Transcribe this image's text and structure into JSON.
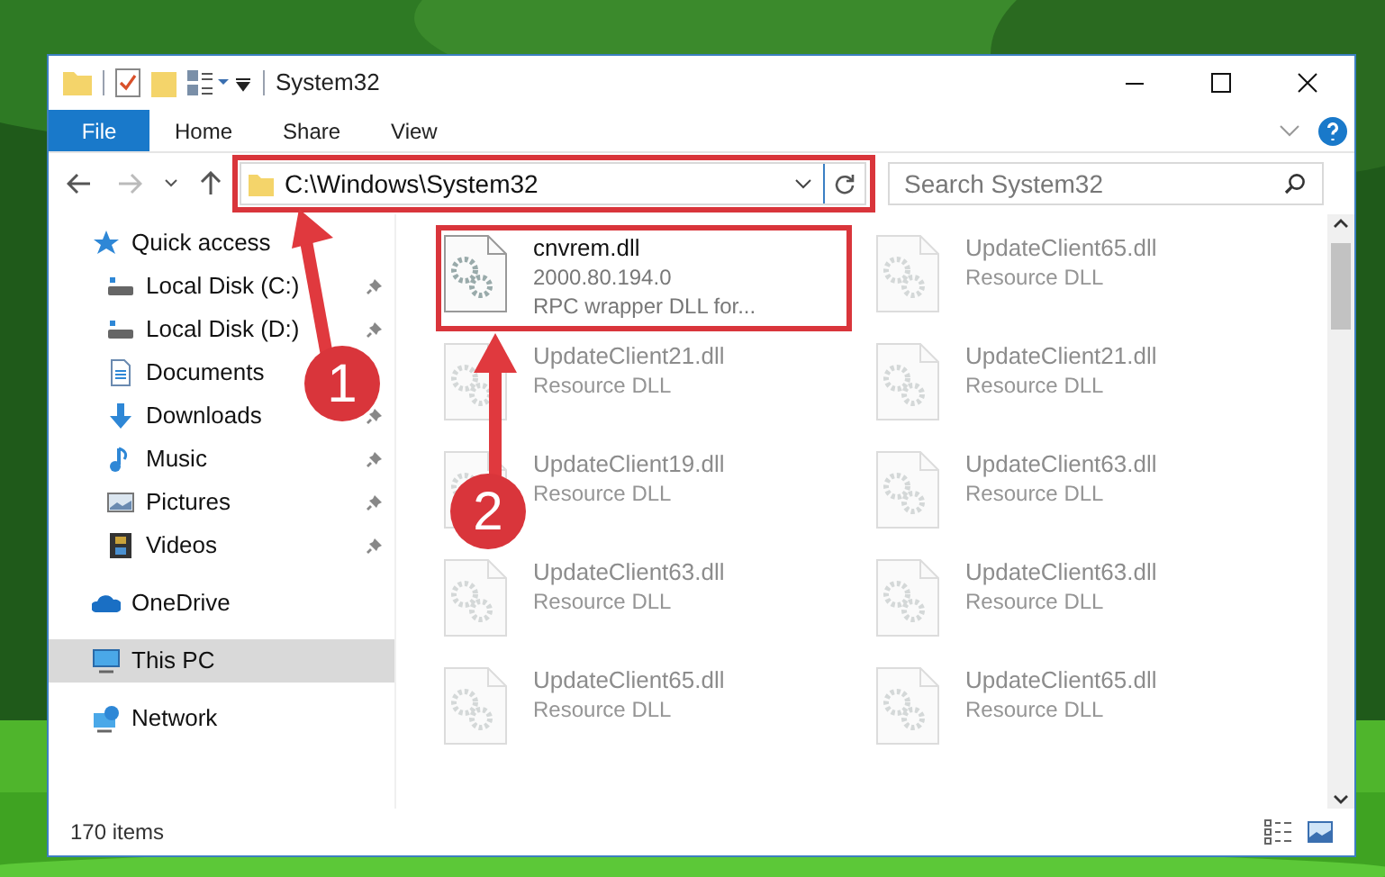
{
  "window": {
    "title": "System32"
  },
  "ribbon_tabs": [
    {
      "label": "File",
      "selected": true
    },
    {
      "label": "Home",
      "selected": false
    },
    {
      "label": "Share",
      "selected": false
    },
    {
      "label": "View",
      "selected": false
    }
  ],
  "address": {
    "value": "C:\\Windows\\System32"
  },
  "search": {
    "placeholder": "Search System32"
  },
  "nav": [
    {
      "label": "Quick access",
      "kind": "star",
      "pinned": false,
      "selected": false,
      "group": true
    },
    {
      "label": "Local Disk (C:)",
      "kind": "disk",
      "pinned": true,
      "selected": false,
      "group": false
    },
    {
      "label": "Local Disk (D:)",
      "kind": "disk",
      "pinned": true,
      "selected": false,
      "group": false
    },
    {
      "label": "Documents",
      "kind": "documents",
      "pinned": false,
      "selected": false,
      "group": false
    },
    {
      "label": "Downloads",
      "kind": "downloads",
      "pinned": true,
      "selected": false,
      "group": false
    },
    {
      "label": "Music",
      "kind": "music",
      "pinned": true,
      "selected": false,
      "group": false
    },
    {
      "label": "Pictures",
      "kind": "pictures",
      "pinned": true,
      "selected": false,
      "group": false
    },
    {
      "label": "Videos",
      "kind": "videos",
      "pinned": true,
      "selected": false,
      "group": false
    },
    {
      "label": "OneDrive",
      "kind": "cloud",
      "pinned": false,
      "selected": false,
      "group": true
    },
    {
      "label": "This PC",
      "kind": "pc",
      "pinned": false,
      "selected": true,
      "group": true
    },
    {
      "label": "Network",
      "kind": "network",
      "pinned": false,
      "selected": false,
      "group": true
    }
  ],
  "files": [
    {
      "name": "cnvrem.dll",
      "details": [
        "2000.80.194.0",
        "RPC wrapper DLL for..."
      ],
      "faded": false
    },
    {
      "name": "UpdateClient65.dll",
      "details": [
        "Resource DLL"
      ],
      "faded": true
    },
    {
      "name": "UpdateClient21.dll",
      "details": [
        "Resource DLL"
      ],
      "faded": true
    },
    {
      "name": "UpdateClient21.dll",
      "details": [
        "Resource DLL"
      ],
      "faded": true
    },
    {
      "name": "UpdateClient19.dll",
      "details": [
        "Resource DLL"
      ],
      "faded": true
    },
    {
      "name": "UpdateClient63.dll",
      "details": [
        "Resource DLL"
      ],
      "faded": true
    },
    {
      "name": "UpdateClient63.dll",
      "details": [
        "Resource DLL"
      ],
      "faded": true
    },
    {
      "name": "UpdateClient63.dll",
      "details": [
        "Resource DLL"
      ],
      "faded": true
    },
    {
      "name": "UpdateClient65.dll",
      "details": [
        "Resource DLL"
      ],
      "faded": true
    },
    {
      "name": "UpdateClient65.dll",
      "details": [
        "Resource DLL"
      ],
      "faded": true
    }
  ],
  "status_bar": {
    "item_count": "170 items"
  },
  "annotations": [
    {
      "number": "1"
    },
    {
      "number": "2"
    }
  ]
}
